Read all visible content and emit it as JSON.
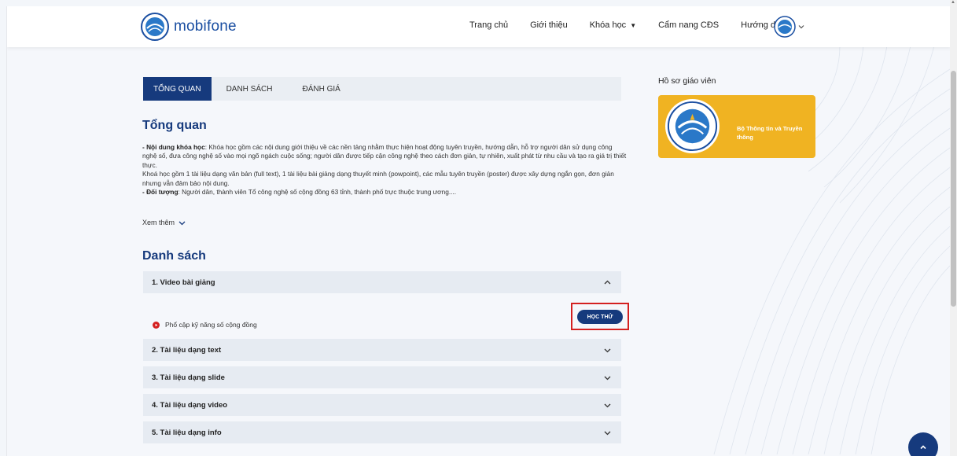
{
  "brand": {
    "name": "mobifone"
  },
  "nav": {
    "items": [
      {
        "label": "Trang chủ"
      },
      {
        "label": "Giới thiệu"
      },
      {
        "label": "Khóa học"
      },
      {
        "label": "Cẩm nang CĐS"
      },
      {
        "label": "Hướng dẫn"
      }
    ]
  },
  "tabs": [
    {
      "label": "TỔNG QUAN",
      "active": true
    },
    {
      "label": "DANH SÁCH",
      "active": false
    },
    {
      "label": "ĐÁNH GIÁ",
      "active": false
    }
  ],
  "overview": {
    "title": "Tổng quan",
    "content_label": "- Nội dung khóa học",
    "content_text": ": Khóa học gồm các nội dung giới thiệu về các nền tảng nhằm thực hiện hoạt động tuyên truyền, hướng dẫn, hỗ trợ người dân sử dụng công nghệ số, đưa công nghệ số vào mọi ngõ ngách cuộc sống; người dân được tiếp cận công nghệ theo cách đơn giản, tự nhiên, xuất phát từ nhu cầu và tạo ra giá trị thiết thực.",
    "materials_text": "Khoá học gồm 1 tài liệu dạng văn bản (full text), 1 tài liệu bài giảng dạng thuyết minh (powpoint), các mẫu tuyên truyền (poster) được xây dựng ngắn gọn, đơn giản nhưng vẫn đảm bảo nội dung.",
    "audience_label": "- Đối tượng",
    "audience_text": ": Người dân, thành viên Tổ công nghệ số cộng đồng 63 tỉnh, thành phố trực thuộc trung ương....",
    "see_more": "Xem thêm"
  },
  "list": {
    "title": "Danh sách",
    "sections": [
      {
        "label": "1. Video bài giảng",
        "expanded": true
      },
      {
        "label": "2. Tài liệu dạng text",
        "expanded": false
      },
      {
        "label": "3. Tài liệu dạng slide",
        "expanded": false
      },
      {
        "label": "4. Tài liệu dạng video",
        "expanded": false
      },
      {
        "label": "5. Tài liệu dạng info",
        "expanded": false
      }
    ],
    "lesson": {
      "title": "Phổ cập kỹ năng số cộng đồng",
      "button": "HỌC THỬ"
    }
  },
  "teacher": {
    "title": "Hồ sơ giáo viên",
    "name": "Bộ Thông tin và Truyền thông"
  },
  "colors": {
    "primary": "#163a7d",
    "accent": "#f0b322",
    "highlight": "#d42020",
    "row_bg": "#e6ebf2"
  },
  "icons": [
    "chevron-down-icon",
    "chevron-up-icon",
    "play-icon",
    "arrow-up-icon"
  ]
}
